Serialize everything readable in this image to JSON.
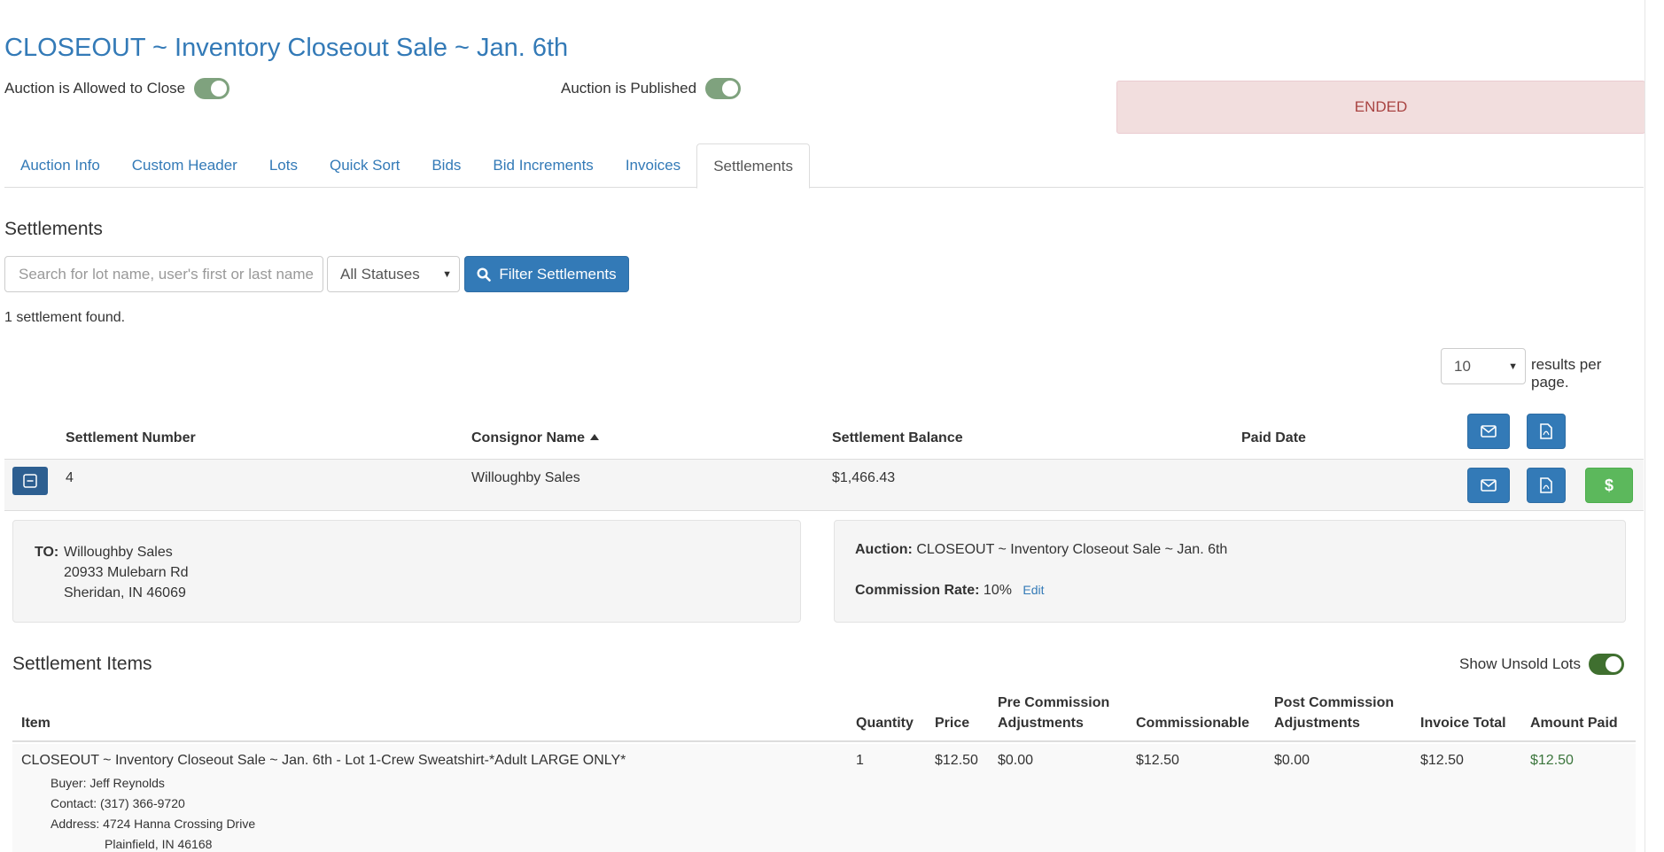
{
  "page_title": "CLOSEOUT ~ Inventory Closeout Sale ~ Jan. 6th",
  "toggles": {
    "allowed_to_close": "Auction is Allowed to Close",
    "published": "Auction is Published"
  },
  "status": "ENDED",
  "tabs": [
    "Auction Info",
    "Custom Header",
    "Lots",
    "Quick Sort",
    "Bids",
    "Bid Increments",
    "Invoices",
    "Settlements"
  ],
  "active_tab": "Settlements",
  "section_title": "Settlements",
  "filter": {
    "search_placeholder": "Search for lot name, user's first or last name",
    "status_selected": "All Statuses",
    "button_label": "Filter Settlements"
  },
  "results_found": "1 settlement found.",
  "per_page": {
    "value": "10",
    "label": "results per page."
  },
  "table": {
    "headers": {
      "number": "Settlement Number",
      "consignor": "Consignor Name",
      "balance": "Settlement Balance",
      "paid_date": "Paid Date"
    },
    "rows": [
      {
        "number": "4",
        "consignor": "Willoughby Sales",
        "balance": "$1,466.43",
        "paid_date": ""
      }
    ]
  },
  "details": {
    "to_label": "TO:",
    "to_name": "Willoughby Sales",
    "to_street": "20933 Mulebarn Rd",
    "to_city": "Sheridan, IN 46069",
    "auction_label": "Auction:",
    "auction_value": "CLOSEOUT ~ Inventory Closeout Sale ~ Jan. 6th",
    "commission_label": "Commission Rate:",
    "commission_value": "10%",
    "edit_label": "Edit"
  },
  "items": {
    "title": "Settlement Items",
    "show_unsold_label": "Show Unsold Lots",
    "headers": {
      "item": "Item",
      "quantity": "Quantity",
      "price": "Price",
      "pre_commission_1": "Pre Commission",
      "pre_commission_2": "Adjustments",
      "commissionable": "Commissionable",
      "post_commission_1": "Post Commission",
      "post_commission_2": "Adjustments",
      "invoice_total": "Invoice Total",
      "amount_paid": "Amount Paid"
    },
    "rows": [
      {
        "item": "CLOSEOUT ~ Inventory Closeout Sale ~ Jan. 6th - Lot 1-Crew Sweatshirt-*Adult LARGE ONLY*",
        "quantity": "1",
        "price": "$12.50",
        "pre_commission": "$0.00",
        "commissionable": "$12.50",
        "post_commission": "$0.00",
        "invoice_total": "$12.50",
        "amount_paid": "$12.50",
        "buyer": "Buyer: Jeff Reynolds",
        "contact": "Contact: (317) 366-9720",
        "address_1": "Address: 4724 Hanna Crossing Drive",
        "address_2": "Plainfield, IN 46168"
      }
    ]
  },
  "icons": {
    "email": "envelope-icon",
    "pdf": "pdf-file-icon",
    "pay": "dollar-icon",
    "collapse": "minus-square-icon",
    "search": "search-icon"
  },
  "colors": {
    "link": "#337ab7",
    "primary": "#337ab7",
    "success": "#5cb85c",
    "danger_bg": "#f2dede",
    "danger_text": "#a94442",
    "paid_text": "#3c763d"
  }
}
